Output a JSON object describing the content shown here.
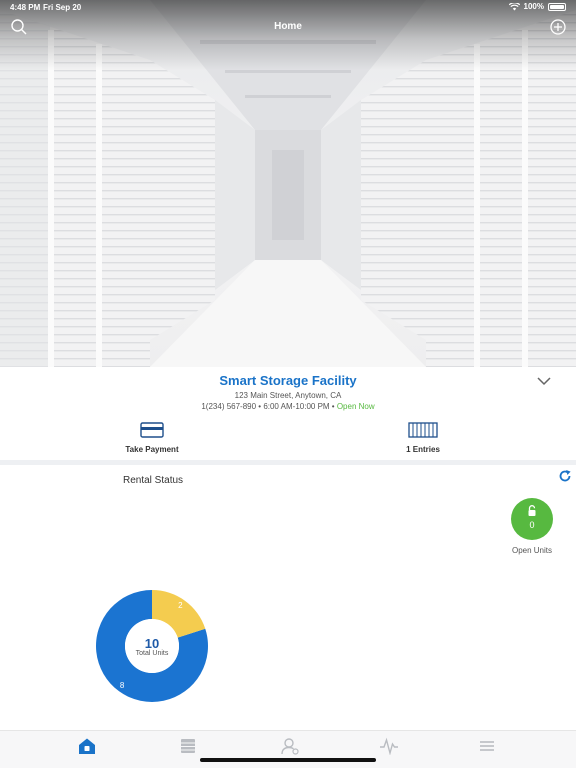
{
  "status_bar": {
    "time": "4:48 PM",
    "date": "Fri Sep 20",
    "battery": "100%"
  },
  "navbar": {
    "title": "Home",
    "left_icon": "search-icon",
    "right_icon": "add-circle-icon"
  },
  "facility": {
    "name": "Smart Storage Facility",
    "address": "123 Main Street, Anytown, CA",
    "info": "1(234) 567-890 • 6:00 AM-10:00 PM •",
    "status": "Open Now",
    "expand_icon": "chevron-down-icon"
  },
  "actions": {
    "take_payment": {
      "label": "Take Payment",
      "icon": "credit-card-icon"
    },
    "entries": {
      "label": "1 Entries",
      "icon": "gate-icon"
    }
  },
  "rental_status": {
    "title": "Rental Status",
    "refresh_icon": "refresh-icon",
    "open_units": {
      "count": "0",
      "label": "Open Units",
      "icon": "unlock-icon",
      "color": "#57b940"
    }
  },
  "chart_data": {
    "type": "pie",
    "donut": true,
    "slices": [
      {
        "value": 8,
        "color": "#1b74d1"
      },
      {
        "value": 2,
        "color": "#f4cc4f"
      }
    ],
    "center_value": "10",
    "center_label": "Total Units"
  },
  "tabbar": {
    "tabs": [
      {
        "icon": "home-icon",
        "active": true
      },
      {
        "icon": "list-icon",
        "active": false
      },
      {
        "icon": "person-icon",
        "active": false
      },
      {
        "icon": "activity-icon",
        "active": false
      },
      {
        "icon": "menu-icon",
        "active": false
      }
    ]
  },
  "colors": {
    "accent": "#1a73c8",
    "open": "#57b940",
    "donut_blue": "#1b74d1",
    "donut_yellow": "#f4cc4f"
  }
}
